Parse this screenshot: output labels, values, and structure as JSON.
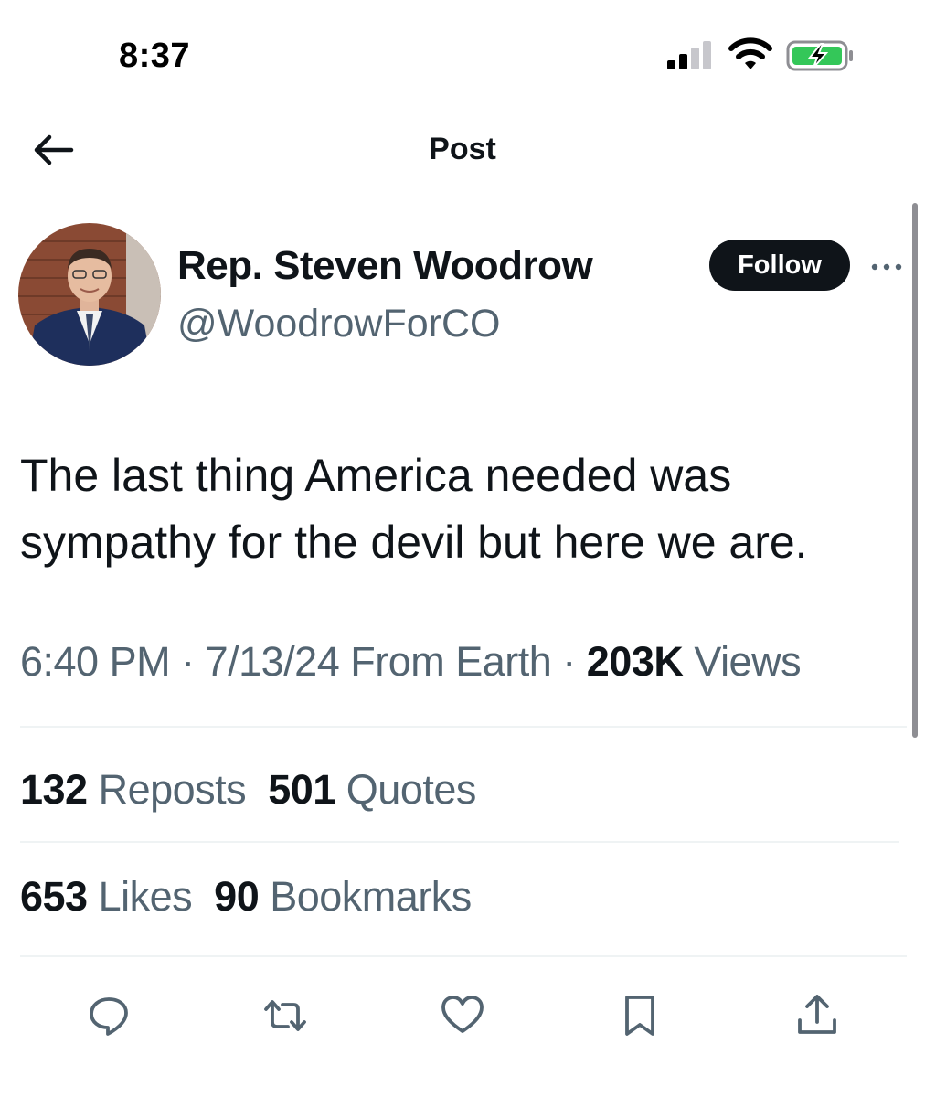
{
  "status_bar": {
    "time": "8:37",
    "icons": [
      "cellular-signal-icon",
      "wifi-icon",
      "battery-charging-icon"
    ],
    "battery_color": "#34c759"
  },
  "header": {
    "title": "Post",
    "back_icon": "arrow-left-icon"
  },
  "author": {
    "display_name": "Rep. Steven Woodrow",
    "handle": "@WoodrowForCO",
    "follow_label": "Follow",
    "more_icon": "more-horizontal-icon"
  },
  "tweet": {
    "text": "The last thing America needed was sympathy for the devil but here we are."
  },
  "meta": {
    "time": "6:40 PM",
    "sep1": " · ",
    "date": "7/13/24",
    "source": " From Earth",
    "sep2": " · ",
    "views_count": "203K",
    "views_label": " Views"
  },
  "stats": {
    "reposts_count": "132",
    "reposts_label": " Reposts",
    "quotes_count": "501",
    "quotes_label": " Quotes",
    "likes_count": "653",
    "likes_label": " Likes",
    "bookmarks_count": "90",
    "bookmarks_label": " Bookmarks"
  },
  "actions": [
    "reply-icon",
    "repost-icon",
    "like-icon",
    "bookmark-icon",
    "share-icon"
  ],
  "colors": {
    "text_primary": "#0f1419",
    "text_secondary": "#536471",
    "divider": "#eff3f4",
    "icon": "#536471"
  }
}
